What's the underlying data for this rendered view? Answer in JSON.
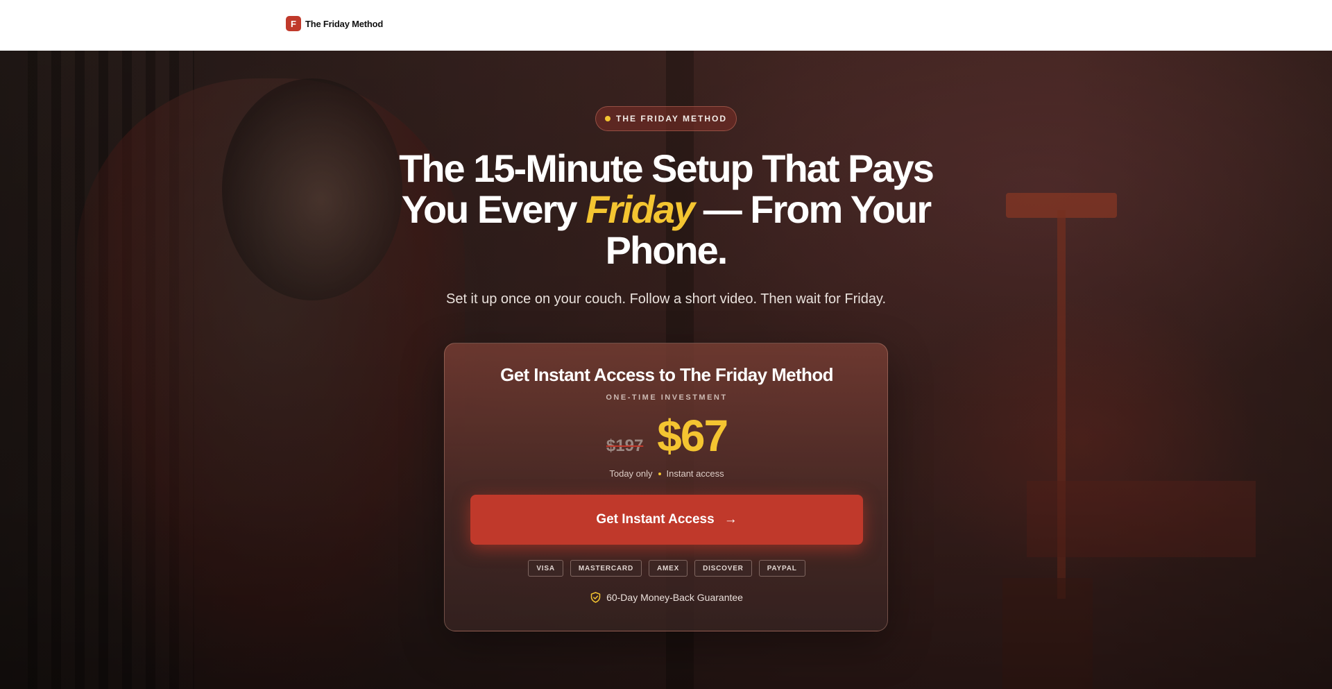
{
  "header": {
    "brand_mark": "F",
    "brand_name": "The Friday Method"
  },
  "hero": {
    "eyebrow": "THE FRIDAY METHOD",
    "headline": {
      "line1": "The 15-Minute Setup That Pays",
      "line2_before": "You Every ",
      "line2_highlight": "Friday",
      "line2_after": " — From Your",
      "line3": "Phone."
    },
    "subheadline": "Set it up once on your couch. Follow a short video. Then wait for Friday."
  },
  "offer_card": {
    "title": "Get Instant Access to The Friday Method",
    "eyebrow": "ONE-TIME INVESTMENT",
    "price_old": "$197",
    "price_new": "$67",
    "note_left": "Today only",
    "note_right": "Instant access",
    "cta_label": "Get Instant Access",
    "cta_arrow": "→",
    "payment_methods": [
      "VISA",
      "MASTERCARD",
      "AMEX",
      "DISCOVER",
      "PAYPAL"
    ],
    "guarantee": "60-Day Money-Back Guarantee"
  },
  "colors": {
    "accent": "#c0392b",
    "highlight": "#f4c531",
    "text": "#ffffff"
  },
  "icons": {
    "guarantee": "shield-check-icon"
  }
}
